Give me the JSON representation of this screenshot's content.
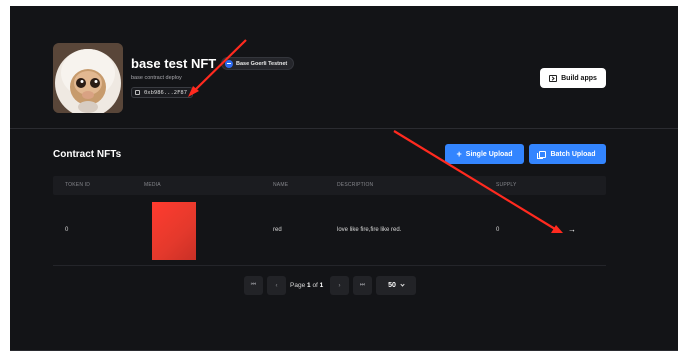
{
  "contract": {
    "name": "base test NFT",
    "network": "Base Goerli Testnet",
    "description": "base contract deploy",
    "address_short": "0xb986...2F87"
  },
  "actions": {
    "build_apps": "Build apps",
    "single_upload": "Single Upload",
    "batch_upload": "Batch Upload"
  },
  "section": {
    "title": "Contract NFTs"
  },
  "table": {
    "columns": {
      "token_id": "TOKEN ID",
      "media": "MEDIA",
      "name": "NAME",
      "description": "DESCRIPTION",
      "supply": "SUPPLY"
    },
    "rows": [
      {
        "token_id": "0",
        "name": "red",
        "description": "love like fire,fire like red.",
        "supply": "0",
        "media_color": "#ef3b2f"
      }
    ]
  },
  "pagination": {
    "first": "⏮",
    "prev": "‹",
    "page_label": "Page",
    "page": "1",
    "of_label": "of",
    "total": "1",
    "next": "›",
    "last": "⏭",
    "page_size": "50"
  },
  "colors": {
    "background": "#131417",
    "accent": "#3385ff",
    "annotation": "#ff2a1f"
  },
  "icons": {
    "network": "base-network-icon",
    "copy": "copy-icon",
    "build": "terminal-icon",
    "single_upload": "plus-icon",
    "batch_upload": "layers-icon",
    "row_action": "arrow-right-icon"
  }
}
